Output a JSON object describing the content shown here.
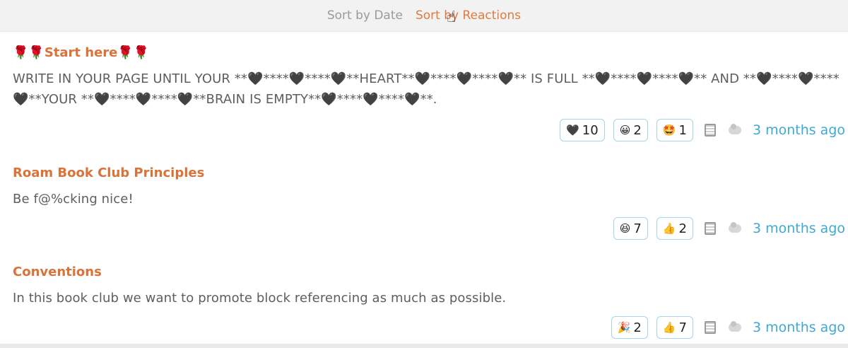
{
  "sort": {
    "by_date": "Sort by Date",
    "by_reactions": "Sort by Reactions",
    "active": "reactions"
  },
  "posts": [
    {
      "title": "🌹🌹Start here🌹🌹",
      "body": "WRITE IN YOUR PAGE UNTIL YOUR **🖤****🖤****🖤**HEART**🖤****🖤****🖤** IS FULL **🖤****🖤****🖤** AND **🖤****🖤****🖤**YOUR **🖤****🖤****🖤**BRAIN IS EMPTY**🖤****🖤****🖤**.",
      "reactions": [
        {
          "emoji": "🖤",
          "count": "10"
        },
        {
          "emoji": "😀",
          "count": "2"
        },
        {
          "emoji": "🤩",
          "count": "1"
        }
      ],
      "time": "3 months ago"
    },
    {
      "title": "Roam Book Club Principles",
      "body": "Be f@%cking nice!",
      "reactions": [
        {
          "emoji": "😆",
          "count": "7"
        },
        {
          "emoji": "👍",
          "count": "2"
        }
      ],
      "time": "3 months ago"
    },
    {
      "title": "Conventions",
      "body": "In this book club we want to promote block referencing as much as possible.",
      "reactions": [
        {
          "emoji": "🎉",
          "count": "2"
        },
        {
          "emoji": "👍",
          "count": "7"
        }
      ],
      "time": "3 months ago"
    }
  ],
  "icons": {
    "calendar": "calendar-icon",
    "cloud": "cloud-icon",
    "cursor": "hand-pointer-cursor"
  },
  "colors": {
    "accent": "#e07a3e",
    "title": "#d9733a",
    "link": "#3fa9d4",
    "reaction_border": "#a7d4e6"
  }
}
